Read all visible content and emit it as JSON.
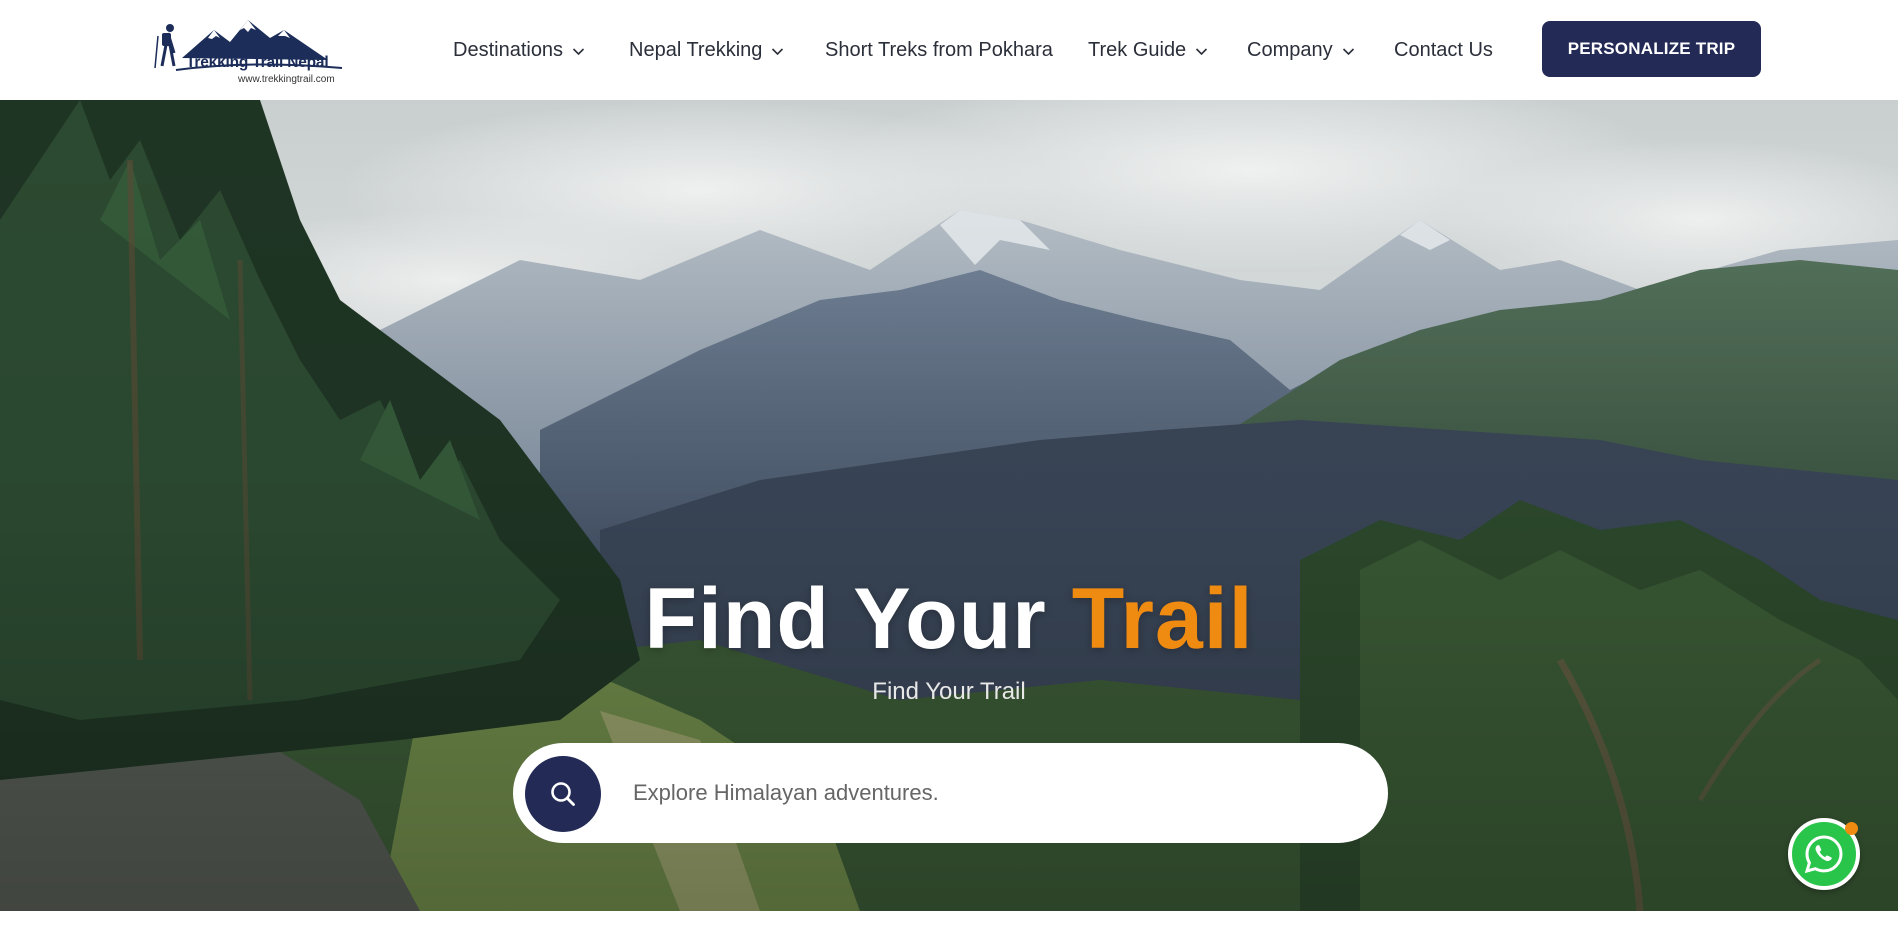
{
  "brand": {
    "name": "Trekking Trail Nepal",
    "url": "www.trekkingtrail.com",
    "logo_icon": "mountain-hiker-logo"
  },
  "nav": {
    "items": [
      {
        "label": "Destinations",
        "has_dropdown": true
      },
      {
        "label": "Nepal Trekking",
        "has_dropdown": true
      },
      {
        "label": "Short Treks from Pokhara",
        "has_dropdown": false
      },
      {
        "label": "Trek Guide",
        "has_dropdown": true
      },
      {
        "label": "Company",
        "has_dropdown": true
      },
      {
        "label": "Contact Us",
        "has_dropdown": false
      }
    ],
    "cta_label": "PERSONALIZE TRIP"
  },
  "hero": {
    "title_main": "Find Your",
    "title_accent": "Trail",
    "subtitle": "Find Your Trail",
    "search": {
      "placeholder": "Explore Himalayan adventures.",
      "value": "",
      "icon": "search-icon"
    }
  },
  "floating": {
    "whatsapp_icon": "whatsapp-icon"
  },
  "colors": {
    "primary": "#222a55",
    "accent": "#f08b12",
    "whatsapp": "#29c44a"
  }
}
